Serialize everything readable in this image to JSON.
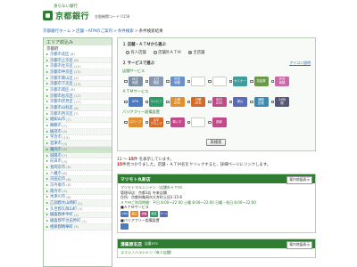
{
  "header": {
    "tagline": "身らない銀行",
    "logo_text": "京都銀行",
    "bank_code": "金融機関コード 0158"
  },
  "breadcrumb": {
    "items": [
      "京都銀行ホーム",
      "店舗・ATMのご案内",
      "条件検索"
    ],
    "current": "条件検索結果"
  },
  "sidebar": {
    "title": "エリア絞込み",
    "head": "京都府",
    "items": [
      {
        "label": "京都市北区",
        "count": "(8)"
      },
      {
        "label": "京都市上京区",
        "count": "(6)"
      },
      {
        "label": "京都市左京区",
        "count": "(12)"
      },
      {
        "label": "京都市中京区",
        "count": "(15)"
      },
      {
        "label": "京都市東山区",
        "count": "(4)"
      },
      {
        "label": "京都市下京区",
        "count": "(13)"
      },
      {
        "label": "京都市南区",
        "count": "(8)"
      },
      {
        "label": "京都市右京区",
        "count": "(12)"
      },
      {
        "label": "京都市伏見区",
        "count": "(17)"
      },
      {
        "label": "京都市山科区",
        "count": "(6)"
      },
      {
        "label": "京都市西京区",
        "count": "(7)"
      },
      {
        "label": "福知山市",
        "count": "(7)"
      },
      {
        "label": "舞鶴市",
        "count": "(7)"
      },
      {
        "label": "綾部市",
        "count": "(4)"
      },
      {
        "label": "宇治市",
        "count": "(13)"
      },
      {
        "label": "宮津市",
        "count": "(3)"
      },
      {
        "label": "亀岡市",
        "count": "(6)"
      },
      {
        "label": "城陽市",
        "count": "(7)"
      },
      {
        "label": "向日市",
        "count": "(3)"
      },
      {
        "label": "長岡京市",
        "count": "(6)"
      },
      {
        "label": "八幡市",
        "count": "(6)"
      },
      {
        "label": "京田辺市",
        "count": "(6)"
      },
      {
        "label": "京丹後市",
        "count": "(8)"
      },
      {
        "label": "南丹市",
        "count": "(4)"
      },
      {
        "label": "木津川市",
        "count": "(6)"
      },
      {
        "label": "乙訓郡大山崎町",
        "count": "(1)"
      },
      {
        "label": "久世郡久御山町",
        "count": "(3)"
      },
      {
        "label": "綴喜郡井手町",
        "count": "(1)"
      },
      {
        "label": "綴喜郡宇治田原町",
        "count": "(1)"
      },
      {
        "label": "相楽郡精華町",
        "count": "(3)"
      }
    ],
    "active_index": 16
  },
  "search": {
    "sec1_title": "１ 店舗・ＡＴＭから選ぶ",
    "radios": [
      "有人店舗",
      "店舗外ＡＴＭ",
      "全店舗"
    ],
    "selected_radio": 2,
    "sec2_title": "２ サービスで選ぶ",
    "icon_legend": "アイコン説明",
    "store_services_label": "店舗サービス",
    "store_services": [
      {
        "label": "休日\n相談",
        "color": "#7b8fa6"
      },
      {
        "label": "土日\n相談",
        "color": "#8a97b3"
      },
      {
        "label": "外貨\n両替",
        "color": "#6a8fc5"
      },
      {
        "label": "",
        "color": "#ffffff"
      },
      {
        "label": "",
        "color": "#ffffff"
      },
      {
        "label": "セミナー",
        "color": "#3e9d9b"
      },
      {
        "label": "貸金庫",
        "color": "#6a9a4a"
      },
      {
        "label": "外貨\n両替",
        "color": "#c86aa8"
      }
    ],
    "atm_services_label": "ＡＴＭサービス",
    "atm_services": [
      {
        "label": "ATM",
        "color": "#4a7bc0"
      },
      {
        "label": "コンビニ",
        "color": "#2e9a6a"
      },
      {
        "label": "土曜\nATM",
        "color": "#e09030"
      },
      {
        "label": "日曜\nATM",
        "color": "#d46a2a"
      },
      {
        "label": "祝日\nATM",
        "color": "#c04a8a"
      },
      {
        "label": "振込",
        "color": "#5a6ab8"
      },
      {
        "label": "通帳\n記帳",
        "color": "#3a8ab0"
      },
      {
        "label": "24時\n間",
        "color": "#555577"
      }
    ],
    "barrier_free_label": "バリアフリー設備設置",
    "barrier_free": [
      {
        "label": "スロープ",
        "color": "#e09030"
      },
      {
        "label": "点字\nブロック",
        "color": "#d46a2a"
      },
      {
        "label": "車いす",
        "color": "#c04a8a"
      },
      {
        "label": "",
        "color": "#ffffff"
      },
      {
        "label": "誘導",
        "color": "#c04a8a"
      }
    ],
    "search_button": "再検索"
  },
  "results": {
    "range_prefix": "11 ～ ",
    "range_end": "15",
    "range_suffix": "件 を表示しています。",
    "total_prefix": "",
    "total": "15",
    "total_suffix": "件見つかりました。店舗・ＡＴＭ名をクリックすると、詳細ページにリンクします。"
  },
  "branches": [
    {
      "name": "マツモト丸新店",
      "code": "",
      "map_button": "案内地図表示",
      "kana": "マツモトマルシンテン（店舗外ＡＴＭ）",
      "phone_label": "管理母店：京都3店 外来店舗",
      "address": "住所：京都府亀岡市大井町土田1-15-6",
      "hours": "ＡＴＭご利用時間：平日 8:00～22:00 土曜 8:00～22:00 日曜・祝日 8:00～22:00",
      "atm_label": "■ＡＴＭサービス",
      "atm_icons": [
        {
          "label": "ATM",
          "color": "#4a7bc0"
        },
        {
          "label": "振込",
          "color": "#e09030"
        },
        {
          "label": "通帳",
          "color": "#c04a8a"
        },
        {
          "label": "硬貨",
          "color": "#2e9a6a"
        },
        {
          "label": "カード",
          "color": "#5a6ab8"
        }
      ],
      "barrier_label": "■バリアフリー設備設置",
      "barrier_icons": [
        {
          "label": "",
          "color": "#4a7bc0"
        }
      ]
    },
    {
      "name": "湯篠原支店",
      "code": "店番575",
      "map_button": "案内地図表示",
      "kana": "ユリシノハラシテン（有人店舗）",
      "phone_label": "",
      "address": "",
      "hours": "",
      "atm_label": "",
      "atm_icons": [],
      "barrier_label": "",
      "barrier_icons": []
    }
  ]
}
